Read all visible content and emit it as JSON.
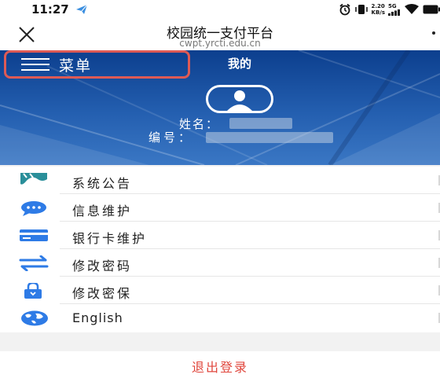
{
  "status_bar": {
    "time": "11:27",
    "net_speed_value": "2.20",
    "net_speed_unit": "KB/s",
    "network": "5G",
    "icons": [
      "telegram-icon",
      "alarm-icon",
      "vibrate-icon",
      "signal-icon",
      "wifi-icon",
      "battery-icon"
    ]
  },
  "title_bar": {
    "title": "校园统一支付平台",
    "url": "cwpt.yrcti.edu.cn",
    "close_icon": "close-icon",
    "more_icon": "more-icon"
  },
  "header": {
    "menu_label": "菜单",
    "title": "我的",
    "name_label": "姓名：",
    "id_label": "编号：",
    "name_value": "",
    "id_value": "",
    "colors": {
      "banner": "#1f5aa8",
      "highlight": "#dd5a55"
    }
  },
  "menu": {
    "items": [
      {
        "label": "系统公告",
        "icon": "announcement-icon"
      },
      {
        "label": "信息维护",
        "icon": "chat-bubble-icon"
      },
      {
        "label": "银行卡维护",
        "icon": "bank-card-icon"
      },
      {
        "label": "修改密码",
        "icon": "exchange-arrows-icon"
      },
      {
        "label": "修改密保",
        "icon": "lock-icon"
      },
      {
        "label": "English",
        "icon": "globe-icon"
      }
    ],
    "colors": {
      "icon_blue": "#2e7be6",
      "icon_teal": "#2a8f9a"
    }
  },
  "logout": {
    "label": "退出登录",
    "color": "#e0463c"
  }
}
